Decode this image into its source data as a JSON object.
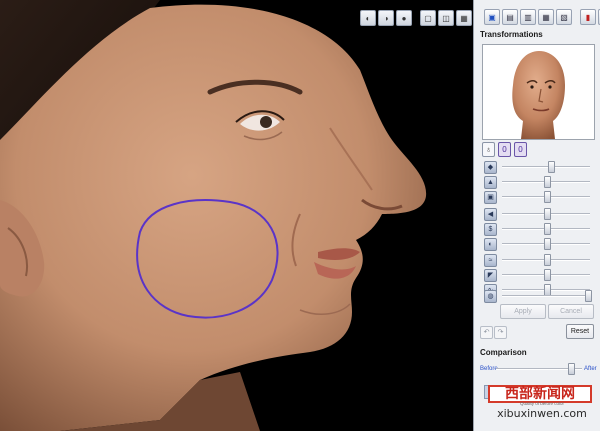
{
  "panel": {
    "transformations_title": "Transformations",
    "mode_buttons": [
      "♁",
      "0",
      "0"
    ],
    "apply_label": "Apply",
    "cancel_label": "Cancel",
    "reset_label": "Reset",
    "comparison_title": "Comparison",
    "before_label": "Before",
    "after_label": "After",
    "sliders": [
      {
        "icon": "reshape-icon",
        "glyph": "◆",
        "level": 0.55
      },
      {
        "icon": "lift-icon",
        "glyph": "▲",
        "level": 0.5
      },
      {
        "icon": "expand-icon",
        "glyph": "▣",
        "level": 0.5
      },
      {
        "icon": "move-icon",
        "glyph": "◀",
        "level": 0.5
      },
      {
        "icon": "volume-icon",
        "glyph": "$",
        "level": 0.5
      },
      {
        "icon": "cheek-icon",
        "glyph": "◐",
        "level": 0.5
      },
      {
        "icon": "smooth-icon",
        "glyph": "≈",
        "level": 0.5
      },
      {
        "icon": "shape-icon",
        "glyph": "◤",
        "level": 0.5
      },
      {
        "icon": "wave-icon",
        "glyph": "∿",
        "level": 0.5
      }
    ],
    "intensity_level": 0.97,
    "comparison_level": 0.86
  },
  "watermark": {
    "title": "西部新闻网",
    "url": "xibuxinwen.com",
    "small_text": "Quality of before color"
  },
  "colors": {
    "outline": "#5a34c8",
    "accent": "#2a50c8",
    "watermark_red": "#c8261c"
  }
}
